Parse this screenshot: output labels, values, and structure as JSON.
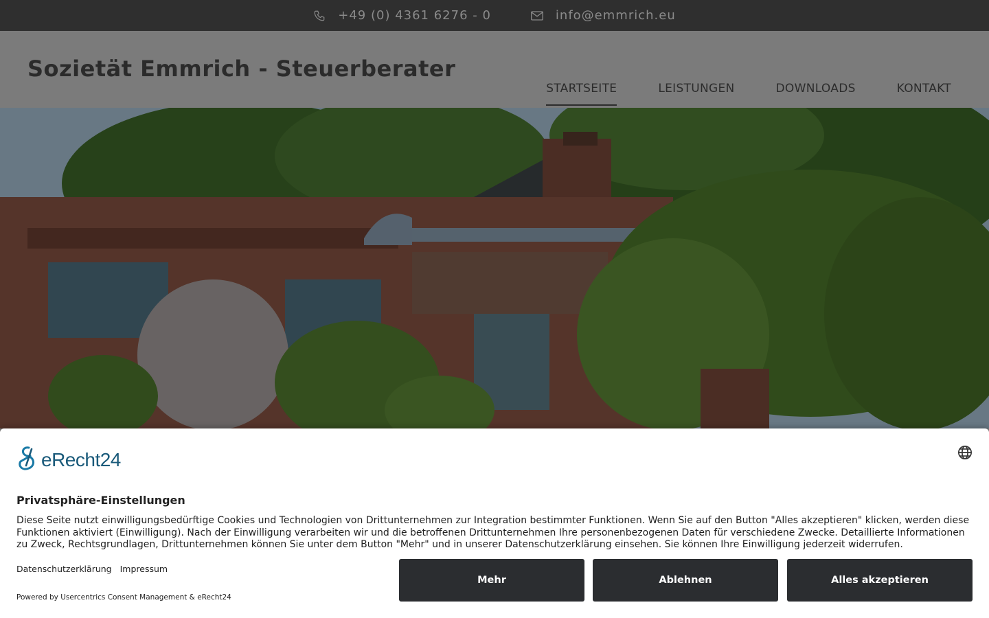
{
  "topbar": {
    "phone": "+49 (0) 4361 6276 - 0",
    "phone_icon": "phone-icon",
    "email": "info@emmrich.eu",
    "email_icon": "envelope-icon"
  },
  "header": {
    "title": "Sozietät Emmrich - Steuerberater",
    "nav": [
      {
        "label": "STARTSEITE",
        "active": true
      },
      {
        "label": "LEISTUNGEN",
        "active": false
      },
      {
        "label": "DOWNLOADS",
        "active": false
      },
      {
        "label": "KONTAKT",
        "active": false
      }
    ]
  },
  "hero": {
    "image": "office-building-photo"
  },
  "consent": {
    "brand": "eRecht24",
    "brand_icon": "erecht24-logo-icon",
    "language_icon": "globe-icon",
    "title": "Privatsphäre-Einstellungen",
    "text": "Diese Seite nutzt einwilligungsbedürftige Cookies und Technologien von Drittunternehmen zur Integration bestimmter Funktionen. Wenn Sie auf den Button \"Alles akzeptieren\" klicken, werden diese Funktionen aktiviert (Einwilligung). Nach der Einwilligung verarbeiten wir und die betroffenen Drittunternehmen Ihre personenbezogenen Daten für verschiedene Zwecke. Detaillierte Informationen zu Zweck, Rechtsgrundlagen, Drittunternehmen können Sie unter dem Button \"Mehr\" und in unserer Datenschutzerklärung einsehen. Sie können Ihre Einwilligung jederzeit widerrufen.",
    "links": {
      "privacy": "Datenschutzerklärung",
      "imprint": "Impressum"
    },
    "powered_by": "Powered by Usercentrics Consent Management & eRecht24",
    "buttons": {
      "more": "Mehr",
      "deny": "Ablehnen",
      "accept": "Alles akzeptieren"
    },
    "button_color": "#2b2d30"
  }
}
